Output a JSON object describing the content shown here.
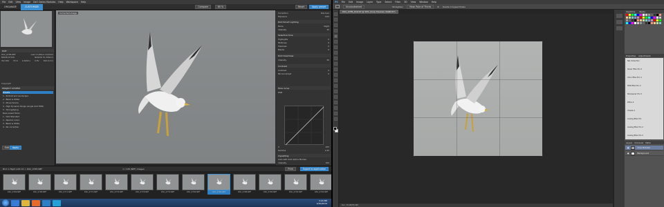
{
  "left_app": {
    "title": "DxO OpticsPro",
    "menu": [
      "File",
      "Edit",
      "View",
      "Image",
      "DxO Optics Modules",
      "Help",
      "Workspace",
      "Help"
    ],
    "tabs": [
      {
        "label": "ORGANIZE",
        "active": false
      },
      {
        "label": "CUSTOMIZE",
        "active": true
      }
    ],
    "toolbar": {
      "compare_label": "Compare",
      "zoom_label": "85 %",
      "reset_label": "Reset",
      "apply_preset_label": "Apply preset"
    },
    "viewer": {
      "correction_label": "Corrected image"
    },
    "exif": {
      "header": "EXIF",
      "row1_left": "DSC_0785.NEF",
      "row1_right": "Last modified: 04/2015",
      "row2_left": "NIKON D7100",
      "row2_right": "NIKKOR 70-300mm",
      "row3": [
        "ISO 400",
        "f/5.6",
        "1/1600 s",
        "0 EV",
        "300.0 mm"
      ]
    },
    "copyright_label": "Copyright",
    "project_header": "PROJECT SYSTEM",
    "tree": [
      {
        "label": "Presets",
        "selected": true
      },
      {
        "label": "1 - Portrait and Landscape",
        "selected": false
      },
      {
        "label": "2 - Black & White",
        "selected": false
      },
      {
        "label": "3 - Monochrome",
        "selected": false
      },
      {
        "label": "4 - High Dynamic Range (single shot HDR)",
        "selected": false
      },
      {
        "label": "5 - Toning/Aging",
        "selected": false
      },
      {
        "label": "New preset folder",
        "selected": false
      },
      {
        "label": "1 - DxO Standard",
        "selected": false
      },
      {
        "label": "2 - Neutral colors",
        "selected": false
      },
      {
        "label": "3 - Black & White",
        "selected": false
      },
      {
        "label": "4 - No correction",
        "selected": false
      }
    ],
    "bottom_buttons": [
      "Edit",
      "Apply"
    ],
    "right_panel": {
      "correction_label": "Correction",
      "correction_value": "Discover",
      "exposure_label": "Exposure",
      "exposure_value": "0.00",
      "smart_lighting": "DxO Smart Lighting",
      "smart_lighting_mode_label": "Mode",
      "smart_lighting_mode": "Slight",
      "intensity_label": "Intensity",
      "intensity_value": "25",
      "selective_tone": "Selective tone",
      "tones": [
        {
          "label": "Highlights",
          "value": "0"
        },
        {
          "label": "Midtones",
          "value": "0"
        },
        {
          "label": "Shadows",
          "value": "0"
        },
        {
          "label": "Blacks",
          "value": "0"
        }
      ],
      "clearview": "DxO ClearView",
      "clearview_intensity": "50",
      "contrast": "Contrast",
      "contrast_label": "Contrast",
      "contrast_value": "0",
      "microcontrast_label": "Microcontrast",
      "microcontrast_value": "0",
      "tone_curve": "Tone curve",
      "rgb_label": "RGB",
      "gamma_label": "Gamma",
      "curve_min": "0",
      "curve_max": "255",
      "gamma_value": "1.00",
      "vignetting": "Vignetting",
      "vignetting_correction": "Auto with DxO Optics Module",
      "vignetting_intensity_label": "Intensity",
      "vignetting_intensity_value": "100"
    },
    "filmstrip_bar": {
      "path": "Bird in flight with 10 > DSC_0785.NEF",
      "count": "1 / 108 (NEF) images",
      "print_label": "Print",
      "export_label": "Export to application"
    },
    "filmstrip": [
      "DSC_0766.NEF",
      "DSC_0768.NEF",
      "DSC_0771.NEF",
      "DSC_0774.NEF",
      "DSC_0776.NEF",
      "DSC_0778.NEF",
      "DSC_0779.NEF",
      "DSC_0782.NEF",
      "DSC_0785.NEF",
      "DSC_0788.NEF",
      "DSC_0790.NEF",
      "DSC_0792.NEF",
      "DSC_0794.NEF"
    ],
    "filmstrip_selected": 8,
    "taskbar_clock": {
      "time": "3:24 PM",
      "date": "4/30/2015"
    }
  },
  "right_app": {
    "menu": [
      "PS",
      "File",
      "Edit",
      "Image",
      "Layer",
      "Type",
      "Select",
      "Filter",
      "3D",
      "View",
      "Window",
      "Help"
    ],
    "options": [
      "Unconstrained",
      "Straighten",
      "View: Rule of Thirds",
      "Delete Cropped Pixels"
    ],
    "doc_tab": "DSC_0785_DxO.tif @ 50% (Crop Preview, RGB/16*)",
    "status": "Doc: 35.9M/35.9M",
    "panels": {
      "tabs1": [
        "Swatches",
        "Styles"
      ],
      "tabs2": [
        "Properties",
        "Adjustments"
      ],
      "list": [
        "Nik Collection",
        "Silver Efex Pro 2",
        "Color Efex Pro 4",
        "HDR Efex Pro 2",
        "Sharpener Pro 3",
        "Dfine 2",
        "Viveza 2",
        "Analog Efex Pro",
        "Analog Efex Pro 2",
        "Analog Efex Pro 2"
      ],
      "layers_tabs": [
        "Layers",
        "Channels",
        "Paths"
      ],
      "layers": [
        {
          "label": "Crop Preview",
          "selected": true
        },
        {
          "label": "Background",
          "selected": false
        }
      ]
    }
  }
}
